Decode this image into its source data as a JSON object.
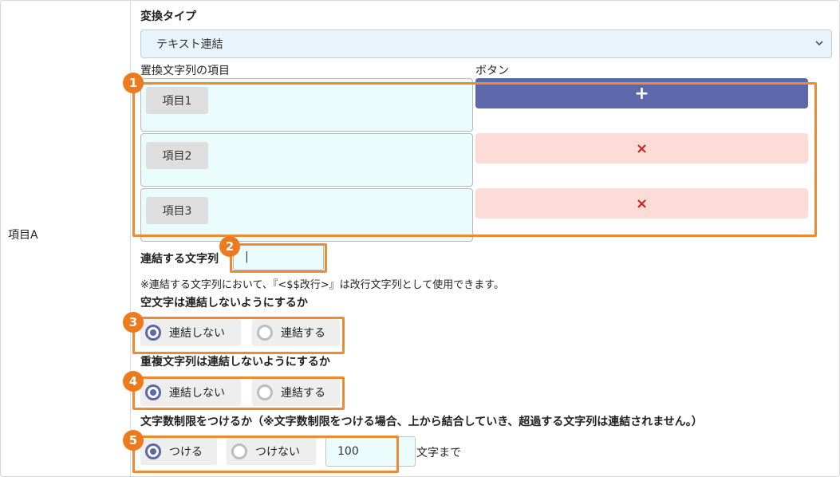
{
  "field": {
    "label": "項目A"
  },
  "conversion": {
    "heading": "変換タイプ",
    "selected": "テキスト連結"
  },
  "columns": {
    "items_header": "置換文字列の項目",
    "buttons_header": "ボタン"
  },
  "items": [
    {
      "label": "項目1",
      "button": "+"
    },
    {
      "label": "項目2",
      "button": "×"
    },
    {
      "label": "項目3",
      "button": "×"
    }
  ],
  "join": {
    "label": "連結する文字列",
    "value": "|",
    "note": "※連結する文字列において、『<$$改行>』は改行文字列として使用できます。"
  },
  "empty_option": {
    "heading": "空文字は連結しないようにするか",
    "options": [
      {
        "label": "連結しない",
        "selected": true
      },
      {
        "label": "連結する",
        "selected": false
      }
    ]
  },
  "duplicate_option": {
    "heading": "重複文字列は連結しないようにするか",
    "options": [
      {
        "label": "連結しない",
        "selected": true
      },
      {
        "label": "連結する",
        "selected": false
      }
    ]
  },
  "limit_option": {
    "heading": "文字数制限をつけるか（※文字数制限をつける場合、上から結合していき、超過する文字列は連結されません。）",
    "options": [
      {
        "label": "つける",
        "selected": true
      },
      {
        "label": "つけない",
        "selected": false
      }
    ],
    "value": "100",
    "suffix": "文字まで"
  },
  "callouts": [
    "1",
    "2",
    "3",
    "4",
    "5"
  ],
  "colors": {
    "accent": "#5c68a9",
    "callout": "#ee8a34",
    "delete_bg": "#fddcd8",
    "delete_fg": "#d21f1f",
    "input_bg": "#e9fcfb",
    "select_bg": "#e8f3fc"
  },
  "icons": {
    "select_arrow": "chevron-down-icon",
    "add": "plus-icon",
    "delete": "close-icon"
  }
}
